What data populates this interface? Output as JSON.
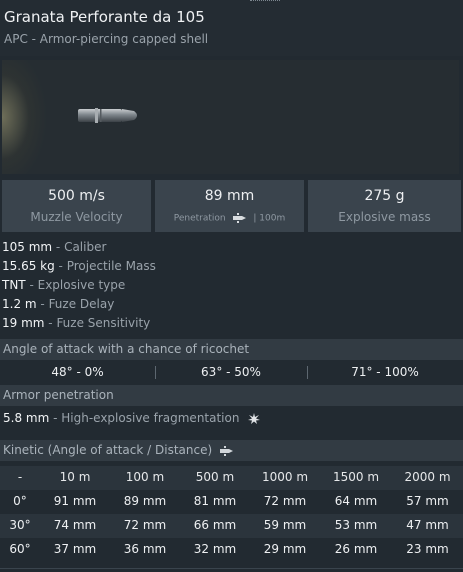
{
  "header": {
    "title": "Granata Perforante da 105",
    "subtitle": "APC - Armor-piercing capped shell"
  },
  "stats": {
    "muzzle_velocity": {
      "value": "500 m/s",
      "label": "Muzzle Velocity"
    },
    "penetration": {
      "value": "89 mm",
      "label": "Penetration",
      "distance": "| 100m"
    },
    "explosive_mass": {
      "value": "275 g",
      "label": "Explosive mass"
    }
  },
  "properties": [
    {
      "value": "105 mm",
      "label": "Caliber"
    },
    {
      "value": "15.65 kg",
      "label": "Projectile Mass"
    },
    {
      "value": "TNT",
      "label": "Explosive type"
    },
    {
      "value": "1.2 m",
      "label": "Fuze Delay"
    },
    {
      "value": "19 mm",
      "label": "Fuze Sensitivity"
    }
  ],
  "ricochet": {
    "title": "Angle of attack with a chance of ricochet",
    "values": [
      "48° - 0%",
      "63° - 50%",
      "71° - 100%"
    ]
  },
  "armor": {
    "title": "Armor penetration",
    "he_value": "5.8 mm",
    "he_label": "High-explosive fragmentation"
  },
  "kinetic": {
    "title": "Kinetic (Angle of attack / Distance)",
    "headers": [
      "-",
      "10 m",
      "100 m",
      "500 m",
      "1000 m",
      "1500 m",
      "2000 m"
    ],
    "rows": [
      [
        "0°",
        "91 mm",
        "89 mm",
        "81 mm",
        "72 mm",
        "64 mm",
        "57 mm"
      ],
      [
        "30°",
        "74 mm",
        "72 mm",
        "66 mm",
        "59 mm",
        "53 mm",
        "47 mm"
      ],
      [
        "60°",
        "37 mm",
        "36 mm",
        "32 mm",
        "29 mm",
        "26 mm",
        "23 mm"
      ]
    ]
  },
  "colors": {
    "background": "#222a31",
    "stat_box": "#3a444d",
    "section_bar": "#323b43",
    "muted_text": "#9aa3ab"
  }
}
